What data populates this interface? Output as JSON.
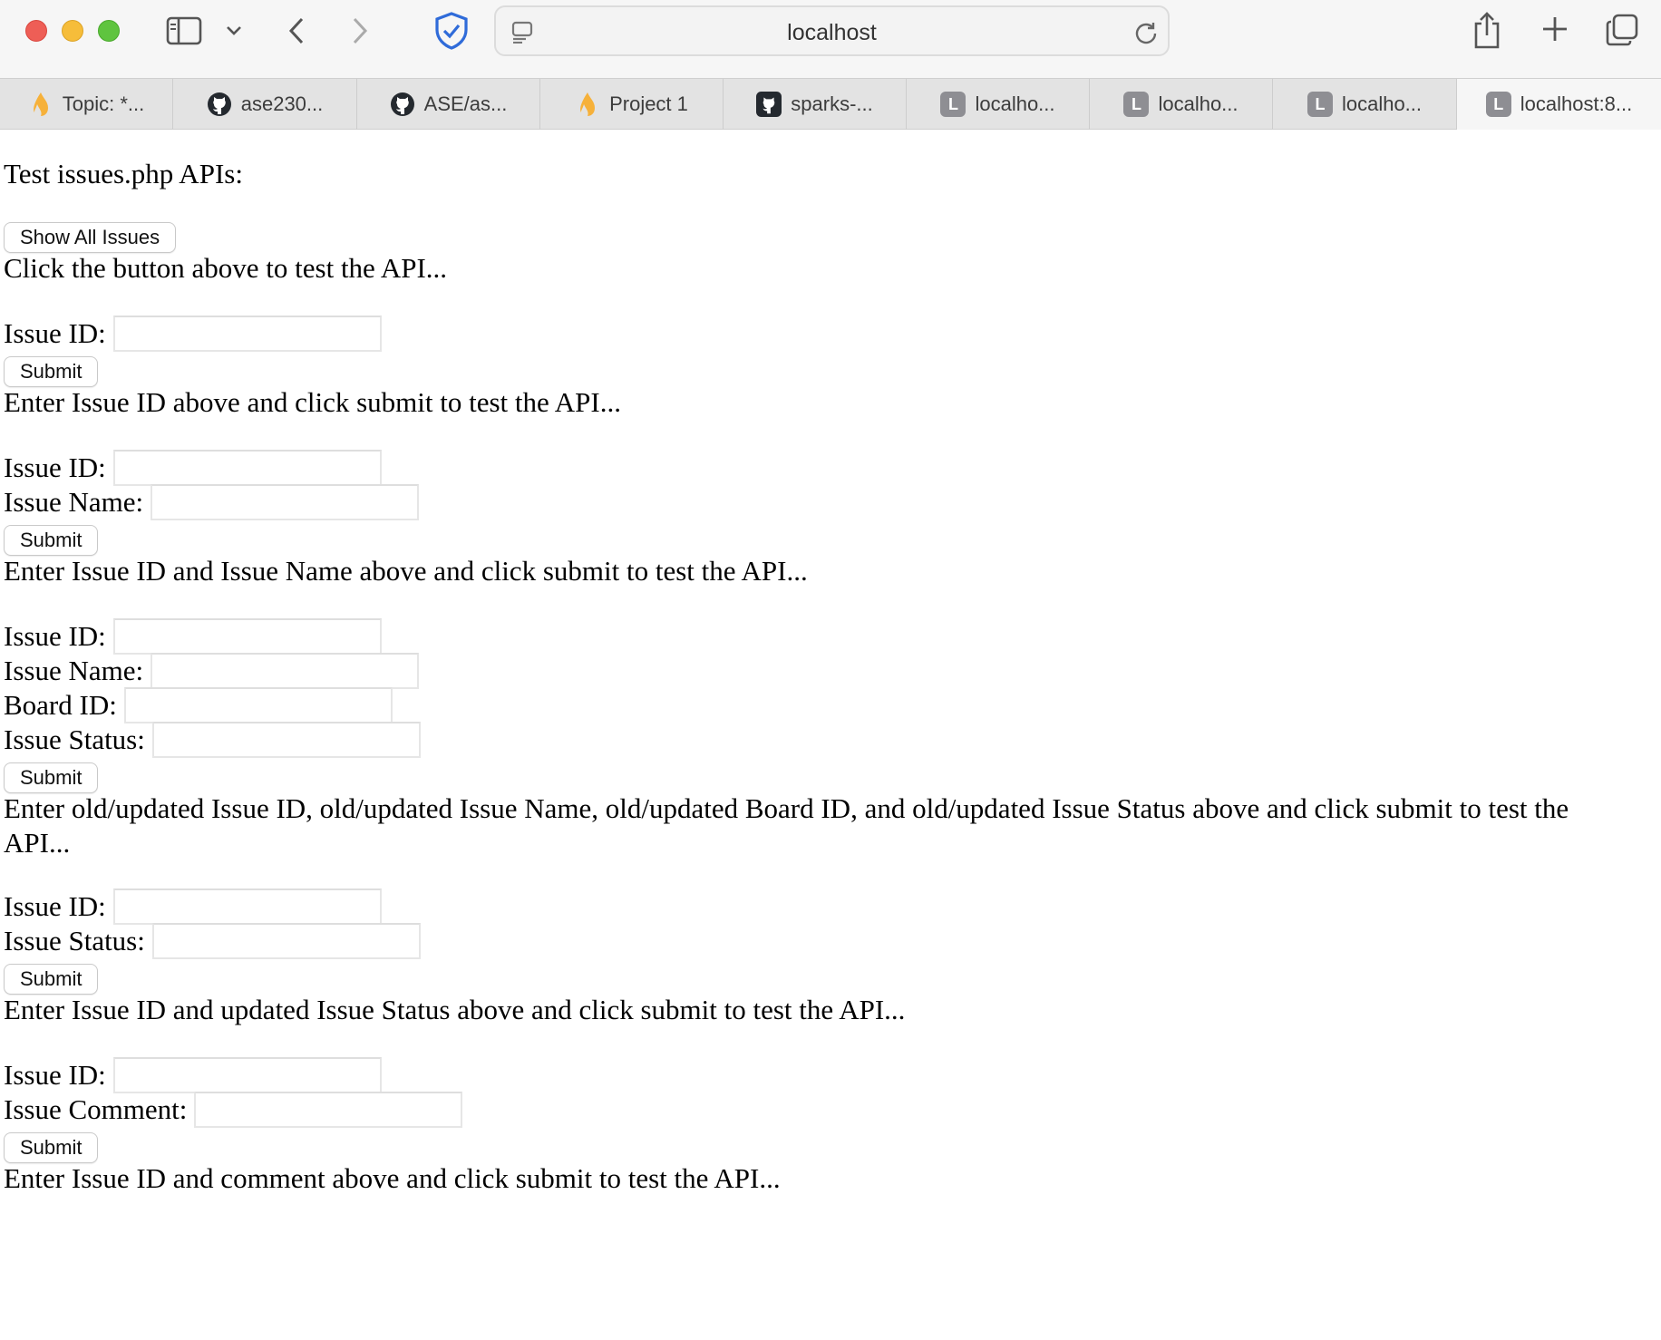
{
  "browser": {
    "url": "localhost",
    "tabs": [
      {
        "label": "Topic: *...",
        "icon": "flame-icon"
      },
      {
        "label": "ase230...",
        "icon": "github-icon"
      },
      {
        "label": "ASE/as...",
        "icon": "github-icon"
      },
      {
        "label": "Project 1",
        "icon": "flame-icon"
      },
      {
        "label": "sparks-...",
        "icon": "github-icon"
      },
      {
        "label": "localho...",
        "icon": "letter-l-icon",
        "letter": "L"
      },
      {
        "label": "localho...",
        "icon": "letter-l-icon",
        "letter": "L"
      },
      {
        "label": "localho...",
        "icon": "letter-l-icon",
        "letter": "L"
      },
      {
        "label": "localhost:8...",
        "icon": "letter-l-icon",
        "letter": "L",
        "active": true
      }
    ]
  },
  "page": {
    "heading": "Test issues.php APIs:",
    "show_all": {
      "button": "Show All Issues",
      "message": "Click the button above to test the API..."
    },
    "get_issue": {
      "fields": [
        {
          "label": "Issue ID:",
          "value": ""
        }
      ],
      "button": "Submit",
      "message": "Enter Issue ID above and click submit to test the API..."
    },
    "create_issue": {
      "fields": [
        {
          "label": "Issue ID:",
          "value": ""
        },
        {
          "label": "Issue Name:",
          "value": ""
        }
      ],
      "button": "Submit",
      "message": "Enter Issue ID and Issue Name above and click submit to test the API..."
    },
    "update_issue": {
      "fields": [
        {
          "label": "Issue ID:",
          "value": ""
        },
        {
          "label": "Issue Name:",
          "value": ""
        },
        {
          "label": "Board ID:",
          "value": ""
        },
        {
          "label": "Issue Status:",
          "value": ""
        }
      ],
      "button": "Submit",
      "message": "Enter old/updated Issue ID, old/updated Issue Name, old/updated Board ID, and old/updated Issue Status above and click submit to test the API..."
    },
    "update_status": {
      "fields": [
        {
          "label": "Issue ID:",
          "value": ""
        },
        {
          "label": "Issue Status:",
          "value": ""
        }
      ],
      "button": "Submit",
      "message": "Enter Issue ID and updated Issue Status above and click submit to test the API..."
    },
    "add_comment": {
      "fields": [
        {
          "label": "Issue ID:",
          "value": ""
        },
        {
          "label": "Issue Comment:",
          "value": ""
        }
      ],
      "button": "Submit",
      "message": "Enter Issue ID and comment above and click submit to test the API..."
    }
  },
  "colors": {
    "close": "#ee5e56",
    "minimize": "#f6bd3a",
    "zoom": "#5fc43f",
    "shield_accent": "#2f6bd9"
  }
}
